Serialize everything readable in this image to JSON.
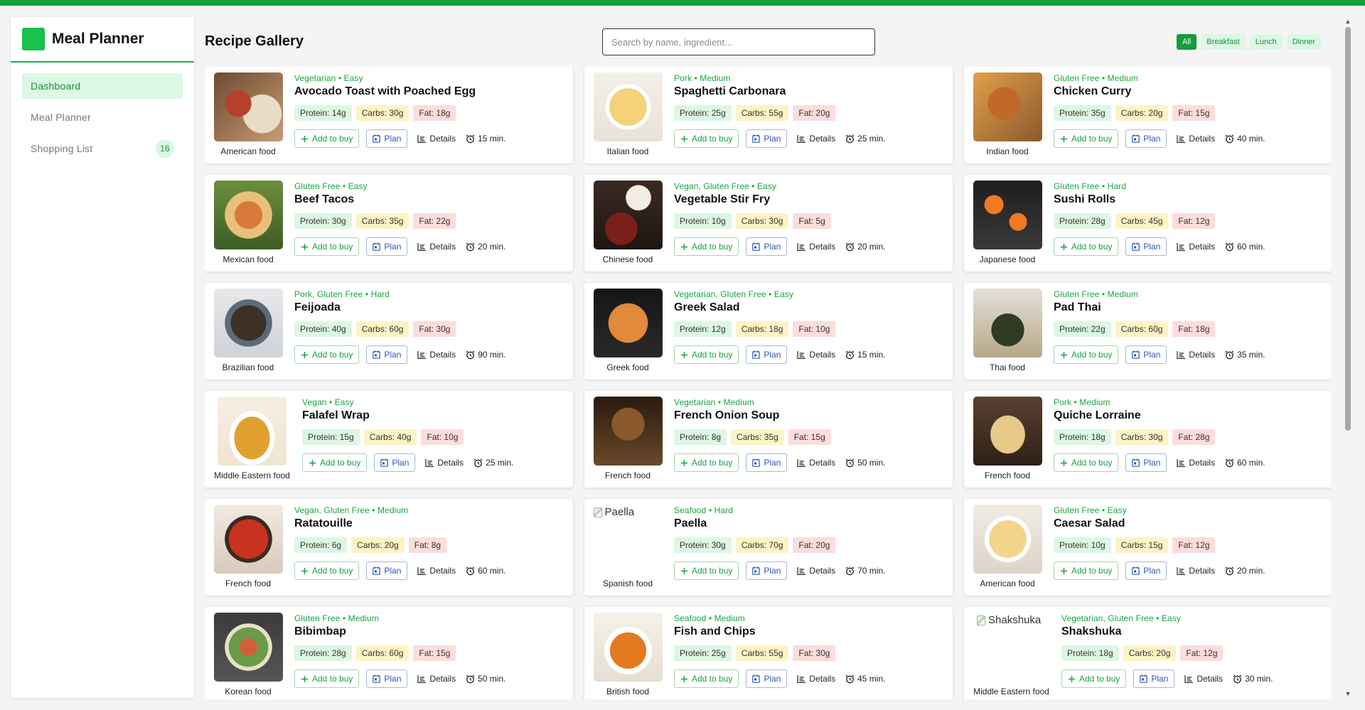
{
  "app": {
    "brand": "Meal Planner",
    "nav": [
      {
        "label": "Dashboard",
        "active": true
      },
      {
        "label": "Meal Planner"
      },
      {
        "label": "Shopping List",
        "badge": "16"
      }
    ]
  },
  "header": {
    "title": "Recipe Gallery",
    "search_placeholder": "Search by name, ingredient...",
    "filters": [
      "All",
      "Breakfast",
      "Lunch",
      "Dinner"
    ],
    "active_filter": "All"
  },
  "labels": {
    "add_to_buy": "Add to buy",
    "plan": "Plan",
    "details": "Details"
  },
  "icons": {
    "add": "plus-icon",
    "plan": "calendar-icon",
    "details": "chart-bars-icon",
    "time": "alarm-clock-icon"
  },
  "colors": {
    "accent": "#169c3a",
    "protein": "#dcf7e3",
    "carbs": "#fdf3c4",
    "fat": "#fddcdc",
    "plan_blue": "#2b57b4"
  },
  "recipes": [
    {
      "tags": "Vegetarian • Easy",
      "name": "Avocado Toast with Poached Egg",
      "cuisine": "American food",
      "protein": "Protein: 14g",
      "carbs": "Carbs: 30g",
      "fat": "Fat: 18g",
      "time": "15 min."
    },
    {
      "tags": "Pork • Medium",
      "name": "Spaghetti Carbonara",
      "cuisine": "Italian food",
      "protein": "Protein: 25g",
      "carbs": "Carbs: 55g",
      "fat": "Fat: 20g",
      "time": "25 min."
    },
    {
      "tags": "Gluten Free • Medium",
      "name": "Chicken Curry",
      "cuisine": "Indian food",
      "protein": "Protein: 35g",
      "carbs": "Carbs: 20g",
      "fat": "Fat: 15g",
      "time": "40 min."
    },
    {
      "tags": "Gluten Free • Easy",
      "name": "Beef Tacos",
      "cuisine": "Mexican food",
      "protein": "Protein: 30g",
      "carbs": "Carbs: 35g",
      "fat": "Fat: 22g",
      "time": "20 min."
    },
    {
      "tags": "Vegan, Gluten Free • Easy",
      "name": "Vegetable Stir Fry",
      "cuisine": "Chinese food",
      "protein": "Protein: 10g",
      "carbs": "Carbs: 30g",
      "fat": "Fat: 5g",
      "time": "20 min."
    },
    {
      "tags": "Gluten Free • Hard",
      "name": "Sushi Rolls",
      "cuisine": "Japanese food",
      "protein": "Protein: 28g",
      "carbs": "Carbs: 45g",
      "fat": "Fat: 12g",
      "time": "60 min."
    },
    {
      "tags": "Pork, Gluten Free • Hard",
      "name": "Feijoada",
      "cuisine": "Brazilian food",
      "protein": "Protein: 40g",
      "carbs": "Carbs: 60g",
      "fat": "Fat: 30g",
      "time": "90 min."
    },
    {
      "tags": "Vegetarian, Gluten Free • Easy",
      "name": "Greek Salad",
      "cuisine": "Greek food",
      "protein": "Protein: 12g",
      "carbs": "Carbs: 18g",
      "fat": "Fat: 10g",
      "time": "15 min."
    },
    {
      "tags": "Gluten Free • Medium",
      "name": "Pad Thai",
      "cuisine": "Thai food",
      "protein": "Protein: 22g",
      "carbs": "Carbs: 60g",
      "fat": "Fat: 18g",
      "time": "35 min."
    },
    {
      "tags": "Vegan • Easy",
      "name": "Falafel Wrap",
      "cuisine": "Middle Eastern food",
      "protein": "Protein: 15g",
      "carbs": "Carbs: 40g",
      "fat": "Fat: 10g",
      "time": "25 min.",
      "wide": true
    },
    {
      "tags": "Vegetarian • Medium",
      "name": "French Onion Soup",
      "cuisine": "French food",
      "protein": "Protein: 8g",
      "carbs": "Carbs: 35g",
      "fat": "Fat: 15g",
      "time": "50 min."
    },
    {
      "tags": "Pork • Medium",
      "name": "Quiche Lorraine",
      "cuisine": "French food",
      "protein": "Protein: 18g",
      "carbs": "Carbs: 30g",
      "fat": "Fat: 28g",
      "time": "60 min."
    },
    {
      "tags": "Vegan, Gluten Free • Medium",
      "name": "Ratatouille",
      "cuisine": "French food",
      "protein": "Protein: 6g",
      "carbs": "Carbs: 20g",
      "fat": "Fat: 8g",
      "time": "60 min."
    },
    {
      "tags": "Seafood • Hard",
      "name": "Paella",
      "cuisine": "Spanish food",
      "protein": "Protein: 30g",
      "carbs": "Carbs: 70g",
      "fat": "Fat: 20g",
      "time": "70 min.",
      "broken_image": "Paella"
    },
    {
      "tags": "Gluten Free • Easy",
      "name": "Caesar Salad",
      "cuisine": "American food",
      "protein": "Protein: 10g",
      "carbs": "Carbs: 15g",
      "fat": "Fat: 12g",
      "time": "20 min."
    },
    {
      "tags": "Gluten Free • Medium",
      "name": "Bibimbap",
      "cuisine": "Korean food",
      "protein": "Protein: 28g",
      "carbs": "Carbs: 60g",
      "fat": "Fat: 15g",
      "time": "50 min."
    },
    {
      "tags": "Seafood • Medium",
      "name": "Fish and Chips",
      "cuisine": "British food",
      "protein": "Protein: 25g",
      "carbs": "Carbs: 55g",
      "fat": "Fat: 30g",
      "time": "45 min."
    },
    {
      "tags": "Vegetarian, Gluten Free • Easy",
      "name": "Shakshuka",
      "cuisine": "Middle Eastern food",
      "protein": "Protein: 18g",
      "carbs": "Carbs: 20g",
      "fat": "Fat: 12g",
      "time": "30 min.",
      "wide": true,
      "broken_image": "Shakshuka"
    }
  ]
}
